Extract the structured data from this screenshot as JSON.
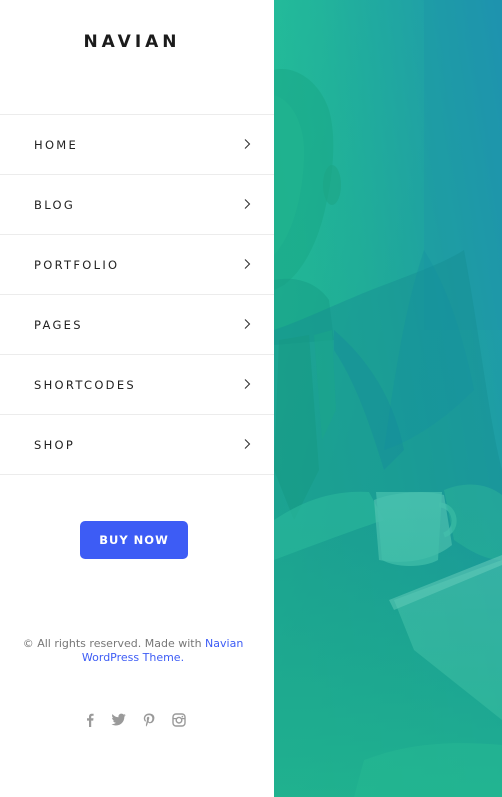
{
  "brand": {
    "logo_text": "NAVIAN"
  },
  "menu": {
    "items": [
      {
        "label": "HOME"
      },
      {
        "label": "BLOG"
      },
      {
        "label": "PORTFOLIO"
      },
      {
        "label": "PAGES"
      },
      {
        "label": "SHORTCODES"
      },
      {
        "label": "SHOP"
      }
    ]
  },
  "cta": {
    "buy_label": "BUY NOW",
    "color": "#3d5cf5"
  },
  "footer": {
    "copyright_prefix": "© All rights reserved. Made with ",
    "link_line1": "Navian",
    "link_line2": "WordPress Theme.",
    "link_color": "#3d5cf5"
  },
  "socials": [
    {
      "icon": "facebook-icon"
    },
    {
      "icon": "twitter-icon"
    },
    {
      "icon": "pinterest-icon"
    },
    {
      "icon": "instagram-icon"
    }
  ],
  "hero": {
    "gradient_top": "#25bf95",
    "gradient_bottom": "#1aa48c",
    "overlay_accent": "#1f9ab0"
  }
}
